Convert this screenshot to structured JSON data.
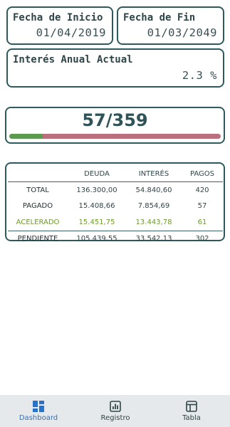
{
  "fecha_inicio": {
    "label": "Fecha de Inicio",
    "value": "01/04/2019"
  },
  "fecha_fin": {
    "label": "Fecha de Fin",
    "value": "01/03/2049"
  },
  "interes": {
    "label": "Interés Anual Actual",
    "value": "2.3 %"
  },
  "progress": {
    "text": "57/359",
    "fraction": 0.1588,
    "fill_color": "#5c9a4f",
    "track_color": "#bb6f7d"
  },
  "table": {
    "headers": [
      "",
      "DEUDA",
      "INTERÉS",
      "PAGOS"
    ],
    "rows": [
      {
        "label": "TOTAL",
        "deuda": "136.300,00",
        "interes": "54.840,60",
        "pagos": "420"
      },
      {
        "label": "PAGADO",
        "deuda": "15.408,66",
        "interes": "7.854,69",
        "pagos": "57"
      },
      {
        "label": "ACELERADO",
        "deuda": "15.451,75",
        "interes": "13.443,78",
        "pagos": "61"
      },
      {
        "label": "PENDIENTE",
        "deuda": "105.439,55",
        "interes": "33.542,13",
        "pagos": "302"
      }
    ],
    "accent_color": "#6e9a2c"
  },
  "tabs": [
    {
      "label": "Dashboard",
      "icon": "dashboard-icon",
      "active": true
    },
    {
      "label": "Registro",
      "icon": "chart-icon",
      "active": false
    },
    {
      "label": "Tabla",
      "icon": "table-icon",
      "active": false
    }
  ],
  "colors": {
    "border": "#2f5a5c",
    "active_tab": "#2a72c8",
    "tabbar_bg": "#e6e9ec"
  }
}
